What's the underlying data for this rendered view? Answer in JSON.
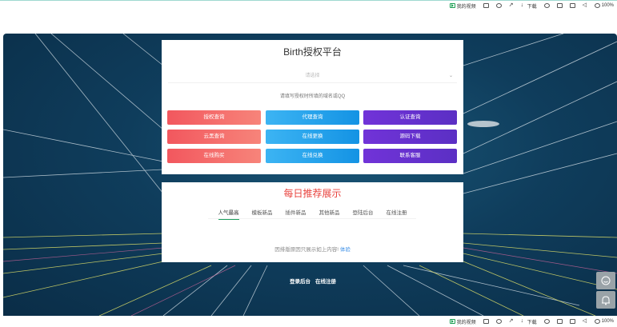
{
  "browser_bar": {
    "items": [
      {
        "label": "我的视频",
        "icon": "play-icon"
      },
      {
        "label": "",
        "icon": "screen-icon"
      },
      {
        "label": "",
        "icon": "chat-icon"
      },
      {
        "label": "",
        "icon": "rocket-icon"
      },
      {
        "label": "下载",
        "icon": "download-icon"
      },
      {
        "label": "",
        "icon": "game-icon"
      },
      {
        "label": "",
        "icon": "copy-icon"
      },
      {
        "label": "",
        "icon": "window-icon"
      },
      {
        "label": "",
        "icon": "volume-icon"
      },
      {
        "label": "100%",
        "icon": "zoom-icon"
      }
    ]
  },
  "platform": {
    "title": "Birth授权平台",
    "select_placeholder": "请选择",
    "search_placeholder": "请填写授权时所填的域名或QQ",
    "buttons": [
      {
        "label": "授权查询",
        "color": "red"
      },
      {
        "label": "代理查询",
        "color": "blue"
      },
      {
        "label": "认证查询",
        "color": "purple"
      },
      {
        "label": "云黑查询",
        "color": "red"
      },
      {
        "label": "在线更换",
        "color": "blue"
      },
      {
        "label": "源码下载",
        "color": "purple"
      },
      {
        "label": "在线购买",
        "color": "red"
      },
      {
        "label": "在线兑换",
        "color": "blue"
      },
      {
        "label": "联系客服",
        "color": "purple"
      }
    ]
  },
  "daily": {
    "title": "每日推荐展示",
    "tabs": [
      "人气最高",
      "模板新品",
      "插件新品",
      "其他新品",
      "登陆后台",
      "在线注册"
    ],
    "active_tab": "人气最高",
    "notice": "因排版原因只展示如上内容!",
    "notice_link": "体验"
  },
  "footer": {
    "links": [
      "登录后台",
      "在线注册"
    ]
  },
  "colors": {
    "accent_red": "#e8423d",
    "active_tab_underline": "#1d9e5e",
    "link": "#3a8ee6"
  }
}
